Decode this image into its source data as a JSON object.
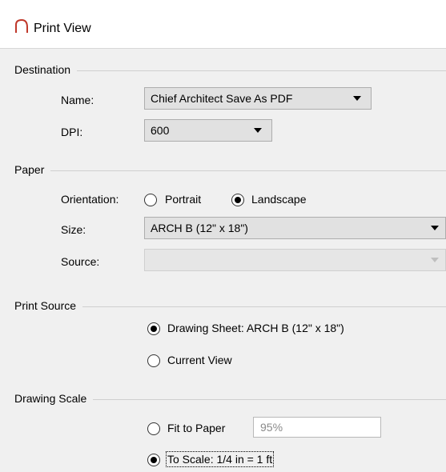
{
  "window": {
    "title": "Print View",
    "icon": "arch-icon"
  },
  "destination": {
    "section_label": "Destination",
    "name_label": "Name:",
    "name_value": "Chief Architect Save As PDF",
    "dpi_label": "DPI:",
    "dpi_value": "600"
  },
  "paper": {
    "section_label": "Paper",
    "orientation_label": "Orientation:",
    "portrait_label": "Portrait",
    "landscape_label": "Landscape",
    "orientation_selected": "Landscape",
    "size_label": "Size:",
    "size_value": "ARCH B  (12\" x 18\")",
    "source_label": "Source:",
    "source_value": ""
  },
  "print_source": {
    "section_label": "Print Source",
    "drawing_sheet_label": "Drawing Sheet: ARCH B  (12\" x 18\")",
    "current_view_label": "Current View",
    "selected": "Drawing Sheet"
  },
  "drawing_scale": {
    "section_label": "Drawing Scale",
    "fit_to_paper_label": "Fit to Paper",
    "fit_percent": "95%",
    "to_scale_label": "To Scale: 1/4 in = 1 ft",
    "selected": "To Scale"
  },
  "colors": {
    "accent_icon": "#c0392b"
  }
}
